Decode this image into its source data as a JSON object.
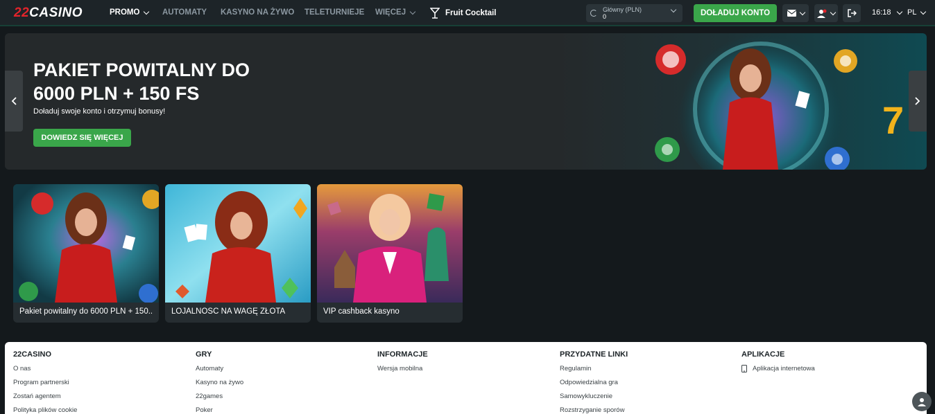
{
  "logo": {
    "num": "22",
    "word": "CASINO"
  },
  "nav": {
    "promo": "PROMO",
    "automaty": "AUTOMATY",
    "live": "KASYNO NA ŻYWO",
    "tele": "TELETURNIEJE",
    "more": "WIĘCEJ",
    "fruit": "Fruit Cocktail"
  },
  "balance": {
    "label": "Główny (PLN)",
    "amount": "0"
  },
  "deposit_label": "DOŁADUJ KONTO",
  "time": "16:18",
  "lang": "PL",
  "hero": {
    "title": "PAKIET POWITALNY DO 6000 PLN + 150 FS",
    "subtitle": "Doładuj swoje konto i otrzymuj bonusy!",
    "cta": "DOWIEDZ SIĘ WIĘCEJ"
  },
  "cards": [
    {
      "caption": "Pakiet powitalny do 6000 PLN + 150..."
    },
    {
      "caption": "LOJALNOŚĆ NA WAGĘ ZŁOTA"
    },
    {
      "caption": "VIP cashback kasyno"
    }
  ],
  "footer": {
    "cols": [
      {
        "title": "22CASINO",
        "links": [
          "O nas",
          "Program partnerski",
          "Zostań agentem",
          "Polityka plików cookie"
        ]
      },
      {
        "title": "GRY",
        "links": [
          "Automaty",
          "Kasyno na żywo",
          "22games",
          "Poker"
        ]
      },
      {
        "title": "INFORMACJE",
        "links": [
          "Wersja mobilna"
        ]
      },
      {
        "title": "PRZYDATNE LINKI",
        "links": [
          "Regulamin",
          "Odpowiedzialna gra",
          "Samowykluczenie",
          "Rozstrzyganie sporów"
        ]
      },
      {
        "title": "APLIKACJE",
        "links": [
          "Aplikacja internetowa"
        ]
      }
    ]
  },
  "colors": {
    "accent": "#3aa64a",
    "nav_bg": "#1d2428",
    "page_bg": "#14191c",
    "logo_red": "#e3242b"
  }
}
